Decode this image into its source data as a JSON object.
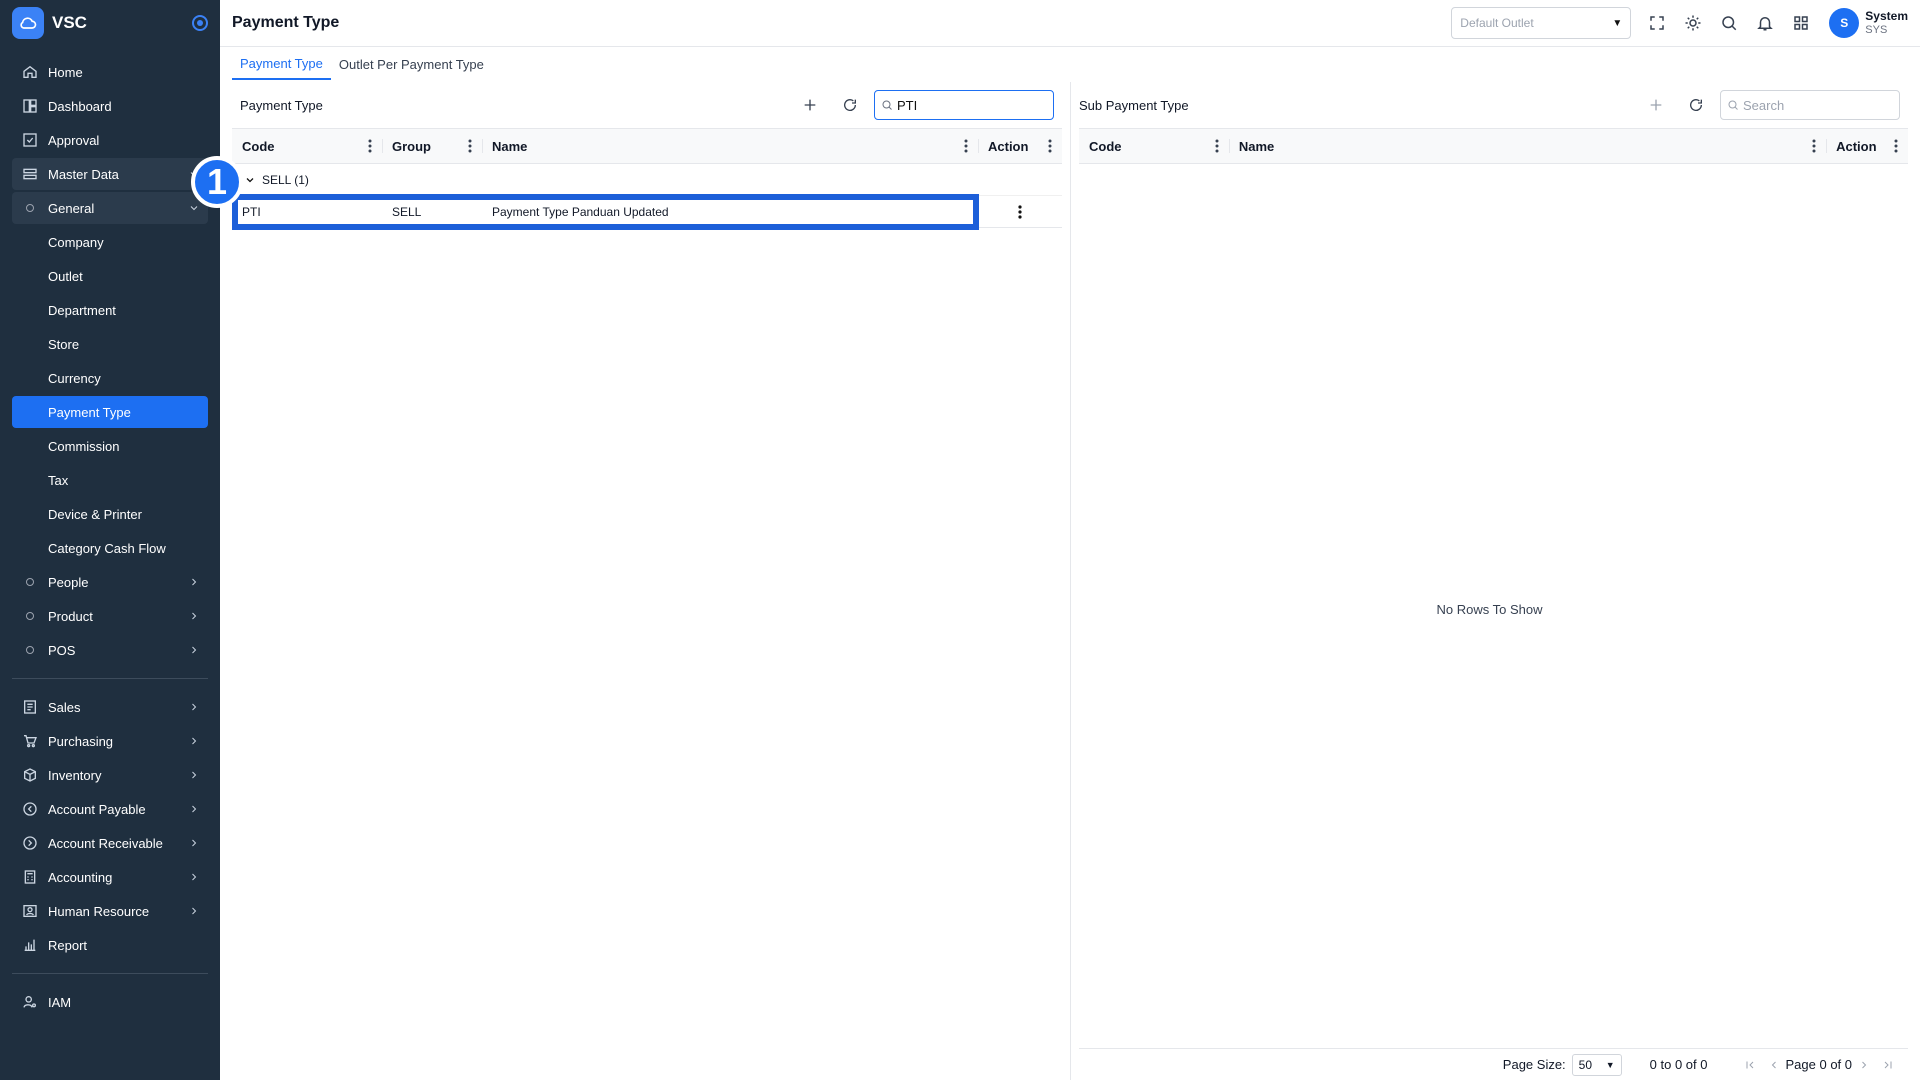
{
  "app": {
    "name": "VSC",
    "page_title": "Payment Type"
  },
  "sidebar": {
    "top_items": [
      {
        "label": "Home",
        "icon": "home-icon"
      },
      {
        "label": "Dashboard",
        "icon": "dashboard-icon"
      },
      {
        "label": "Approval",
        "icon": "approval-icon"
      },
      {
        "label": "Master Data",
        "icon": "database-icon"
      }
    ],
    "general": {
      "label": "General"
    },
    "general_items": [
      "Company",
      "Outlet",
      "Department",
      "Store",
      "Currency",
      "Payment Type",
      "Commission",
      "Tax",
      "Device & Printer",
      "Category Cash Flow"
    ],
    "sub_groups": [
      "People",
      "Product",
      "POS"
    ],
    "modules": [
      {
        "label": "Sales",
        "icon": "sales-icon"
      },
      {
        "label": "Purchasing",
        "icon": "cart-icon"
      },
      {
        "label": "Inventory",
        "icon": "box-icon"
      },
      {
        "label": "Account Payable",
        "icon": "payable-icon"
      },
      {
        "label": "Account Receivable",
        "icon": "receivable-icon"
      },
      {
        "label": "Accounting",
        "icon": "calculator-icon"
      },
      {
        "label": "Human Resource",
        "icon": "person-card-icon"
      },
      {
        "label": "Report",
        "icon": "report-icon"
      }
    ],
    "iam": {
      "label": "IAM"
    }
  },
  "header": {
    "outlet_placeholder": "Default Outlet",
    "user": {
      "initial": "S",
      "name": "System",
      "code": "SYS"
    }
  },
  "tabs": [
    "Payment Type",
    "Outlet Per Payment Type"
  ],
  "step_marker": "1",
  "left_panel": {
    "title": "Payment Type",
    "search_value": "PTI",
    "columns": [
      "Code",
      "Group",
      "Name",
      "Action"
    ],
    "group_label": "SELL (1)",
    "rows": [
      {
        "code": "PTI",
        "group": "SELL",
        "name": "Payment Type Panduan Updated"
      }
    ]
  },
  "right_panel": {
    "title": "Sub Payment Type",
    "search_placeholder": "Search",
    "columns": [
      "Code",
      "Name",
      "Action"
    ],
    "empty_text": "No Rows To Show",
    "footer": {
      "page_size_label": "Page Size:",
      "page_size": "50",
      "range": "0 to 0 of 0",
      "page_info": "Page 0 of 0"
    }
  },
  "colors": {
    "sidebar_bg": "#1f2f3f",
    "accent": "#1d6ff2"
  }
}
